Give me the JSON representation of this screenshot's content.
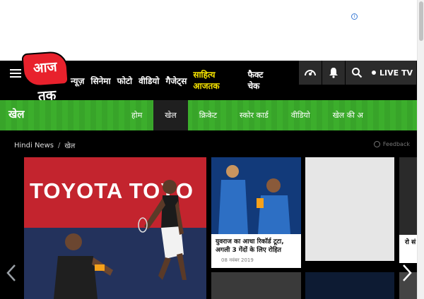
{
  "ad": {
    "info_icon": "i"
  },
  "header": {
    "logo_text": "आज तक",
    "nav": [
      {
        "label": "न्यूज़"
      },
      {
        "label": "सिनेमा"
      },
      {
        "label": "फोटो"
      },
      {
        "label": "वीडियो"
      },
      {
        "label": "गैजेट्स"
      },
      {
        "label_line1": "साहित्य",
        "label_line2": "आजतक"
      },
      {
        "label_line1": "फैक्ट",
        "label_line2": "चेक"
      }
    ],
    "icons": [
      "podcast-icon",
      "bell-icon",
      "search-icon"
    ],
    "live_tv": "LIVE TV"
  },
  "section": {
    "title": "खेल",
    "tabs": [
      {
        "label": "होम",
        "active": false
      },
      {
        "label": "खेल",
        "active": true
      },
      {
        "label": "क्रिकेट",
        "active": false
      },
      {
        "label": "स्कोर कार्ड",
        "active": false
      },
      {
        "label": "वीडियो",
        "active": false
      },
      {
        "label": "खेल की अ",
        "active": false
      }
    ],
    "accent_color": "#3cae2c"
  },
  "breadcrumb": {
    "home": "Hindi News",
    "current": "खेल"
  },
  "feedback": "Feedback",
  "hero": {
    "brand": "TOYOTA TOYO"
  },
  "cards": [
    {
      "caption": "युवराज का आधा रिकॉर्ड टूटा, अगली 3 गेंदों के लिए रोहित",
      "date": "08 नवंबर 2019"
    }
  ],
  "edge_text": "रो सं"
}
